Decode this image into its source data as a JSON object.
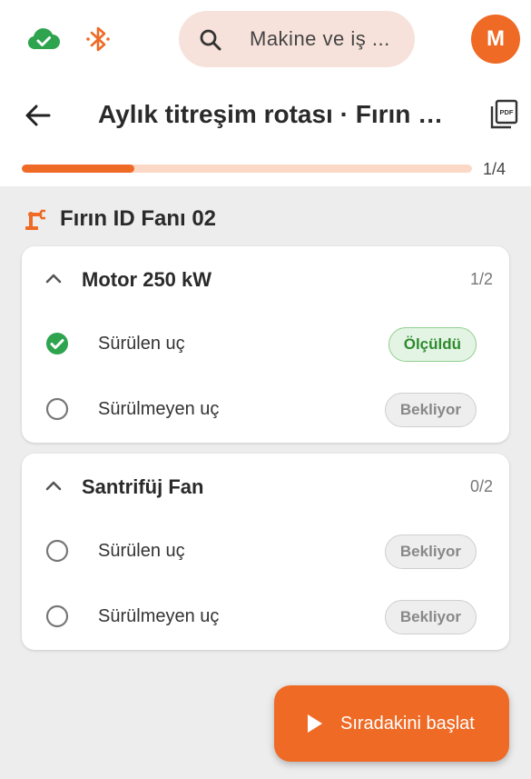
{
  "colors": {
    "accent": "#ee6a25",
    "success": "#2ea44f",
    "bluetooth": "#ee6a25"
  },
  "status_bar": {
    "cloud_icon": "cloud-check-icon",
    "bluetooth_icon": "bluetooth-icon"
  },
  "search": {
    "placeholder": "Makine ve iş ..."
  },
  "user": {
    "avatar_initial": "M"
  },
  "header": {
    "title": "Aylık titreşim rotası · Fırın b..."
  },
  "progress": {
    "value": 0.25,
    "label": "1/4"
  },
  "machine": {
    "name": "Fırın ID Fanı 02",
    "icon": "robot-arm-icon"
  },
  "components": [
    {
      "name": "Motor 250 kW",
      "count": "1/2",
      "points": [
        {
          "label": "Sürülen uç",
          "status": "Ölçüldü",
          "done": true
        },
        {
          "label": "Sürülmeyen uç",
          "status": "Bekliyor",
          "done": false
        }
      ]
    },
    {
      "name": "Santrifüj Fan",
      "count": "0/2",
      "points": [
        {
          "label": "Sürülen uç",
          "status": "Bekliyor",
          "done": false
        },
        {
          "label": "Sürülmeyen uç",
          "status": "Bekliyor",
          "done": false
        }
      ]
    }
  ],
  "fab": {
    "label": "Sıradakini başlat"
  }
}
